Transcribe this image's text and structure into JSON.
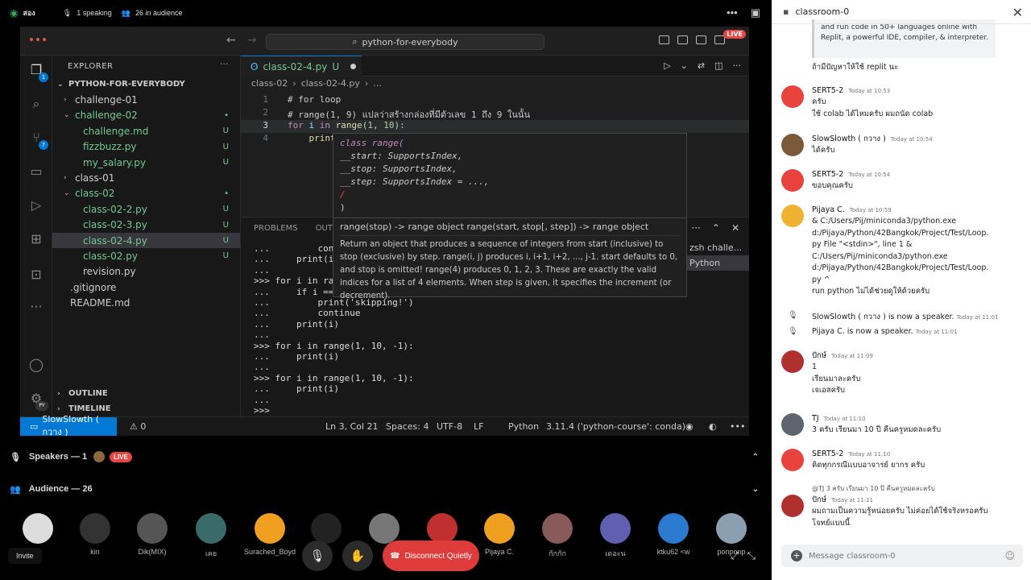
{
  "topbar": {
    "channel": "สอง",
    "speaking": "1 speaking",
    "audience": "26 in audience"
  },
  "vscode": {
    "search": "python-for-everybody",
    "live": "LIVE",
    "explorer_title": "EXPLORER",
    "project": "PYTHON-FOR-EVERYBODY",
    "tree": [
      {
        "label": "challenge-01",
        "indent": 1,
        "chev": "›",
        "cls": "",
        "status": ""
      },
      {
        "label": "challenge-02",
        "indent": 1,
        "chev": "⌄",
        "cls": "teal",
        "status": "•"
      },
      {
        "label": "challenge.md",
        "indent": 2,
        "chev": "",
        "cls": "teal",
        "status": "U"
      },
      {
        "label": "fizzbuzz.py",
        "indent": 2,
        "chev": "",
        "cls": "teal",
        "status": "U"
      },
      {
        "label": "my_salary.py",
        "indent": 2,
        "chev": "",
        "cls": "teal",
        "status": "U"
      },
      {
        "label": "class-01",
        "indent": 1,
        "chev": "›",
        "cls": "",
        "status": ""
      },
      {
        "label": "class-02",
        "indent": 1,
        "chev": "⌄",
        "cls": "teal",
        "status": "•"
      },
      {
        "label": "class-02-2.py",
        "indent": 2,
        "chev": "",
        "cls": "teal",
        "status": "U"
      },
      {
        "label": "class-02-3.py",
        "indent": 2,
        "chev": "",
        "cls": "teal",
        "status": "U"
      },
      {
        "label": "class-02-4.py",
        "indent": 2,
        "chev": "",
        "cls": "teal",
        "status": "U",
        "sel": true
      },
      {
        "label": "class-02.py",
        "indent": 2,
        "chev": "",
        "cls": "teal",
        "status": "U"
      },
      {
        "label": "revision.py",
        "indent": 2,
        "chev": "",
        "cls": "",
        "status": ""
      },
      {
        "label": ".gitignore",
        "indent": 1,
        "chev": "",
        "cls": "",
        "status": ""
      },
      {
        "label": "README.md",
        "indent": 1,
        "chev": "",
        "cls": "",
        "status": ""
      }
    ],
    "outline": "OUTLINE",
    "timeline": "TIMELINE",
    "tab": "class-02-4.py",
    "tab_status": "U",
    "breadcrumb": [
      "class-02",
      "›",
      "class-02-4.py",
      "›",
      "..."
    ],
    "code_lines": [
      "1",
      "2",
      "3",
      "4"
    ],
    "code_comment1": "# for loop",
    "code_comment2": "# range(1, 9) แปลว่าสร้างกล่องที่มีตัวเลข 1 ถึง 9 ในนั้น",
    "sig_class": "class range(",
    "sig_start": "    __start: SupportsIndex,",
    "sig_stop": "    __stop: SupportsIndex,",
    "sig_step": "    __step: SupportsIndex = ...,",
    "sig_slash": "    /",
    "sig_close": ")",
    "doc_head": "range(stop) -> range object range(start, stop[, step]) -> range object",
    "doc_body": "Return an object that produces a sequence of integers from start (inclusive) to stop (exclusive) by step. range(i, j) produces i, i+1, i+2, ..., j-1. start defaults to 0, and stop is omitted! range(4) produces 0, 1, 2, 3. These are exactly the valid indices for a list of 4 elements. When step is given, it specifies the increment (or decrement).",
    "panel_tabs": [
      "PROBLEMS",
      "OUTP"
    ],
    "terminal": "...         cont\n...     print(i)\n...\n>>> for i in rang\n...     if i ==\n...         print('skipping!')\n...         continue\n...     print(i)\n...\n>>> for i in range(1, 10, -1):\n...     print(i)\n...\n>>> for i in range(1, 10, -1):\n...     print(i)\n...\n>>> ",
    "term_list": [
      "zsh  challe...",
      "Python"
    ],
    "status_user": "SlowSlowth ( กวาง )",
    "status_warn": "⚠ 0",
    "status_items": [
      "Ln 3, Col 21",
      "Spaces: 4",
      "UTF-8",
      "LF",
      "Python",
      "3.11.4 ('python-course': conda)"
    ],
    "py_badge": "PY"
  },
  "stage": {
    "speakers": "Speakers — 1",
    "live": "LIVE",
    "audience": "Audience — 26",
    "names": [
      "",
      "kin",
      "Dik(MIX)",
      "เคย",
      "Surached_Boyd",
      "r)",
      "",
      "",
      "Pijaya C.",
      "กักกัก",
      "เดอะน",
      "ktku62 <ᴡ",
      "ponponp"
    ],
    "disconnect": "Disconnect Quietly",
    "invite": "Invite"
  },
  "chat": {
    "channel": "classroom-0",
    "quote": "and run code in 50+ languages online with Replit, a powerful IDE, compiler, & interpreter.",
    "top_line": "ถ้ามีปัญหาให้ใช้ replit นะ",
    "msgs": [
      {
        "name": "SERT5-2",
        "time": "Today at 10:53",
        "lines": [
          "ครับ",
          "ใช้ colab ได้ไหมครับ ผมถนัด colab"
        ]
      },
      {
        "name": "SlowSlowth ( กวาง )",
        "time": "Today at 10:54",
        "lines": [
          "ได้ครับ"
        ]
      },
      {
        "name": "SERT5-2",
        "time": "Today at 10:54",
        "lines": [
          "ขอบคุณครับ"
        ]
      },
      {
        "name": "Pijaya C.",
        "time": "Today at 10:59",
        "lines": [
          "& C:/Users/Pij/miniconda3/python.exe",
          "d:/Pijaya/Python/42Bangkok/Project/Test/Loop.",
          "py  File \"<stdin>\", line 1     &",
          "C:/Users/Pij/miniconda3/python.exe",
          "d:/Pijaya/Python/42Bangkok/Project/Test/Loop.",
          "py    ^",
          "run python ไม่ได้ช่วยดูให้ด้วยครับ"
        ]
      },
      {
        "name": "ปักษ์",
        "time": "Today at 11:09",
        "lines": [
          "1",
          "เรียนมาละครับ",
          "เจเอสครับ"
        ]
      },
      {
        "name": "TJ",
        "time": "Today at 11:10",
        "lines": [
          "3 ครับ เรียนมา 10 ปี คืนครูหมดละครับ"
        ]
      },
      {
        "name": "SERT5-2",
        "time": "Today at 11:10",
        "lines": [
          "คิดทุกกรณีแบบอาจารย์ ยากร ครับ"
        ]
      },
      {
        "name": "ปักษ์",
        "time": "Today at 11:11",
        "lines": [
          "ผมถามเป็นความรู้หน่อยครับ ไม่ค่อยได้ใช้จริงหรอครับ",
          "โจทย์แบบนี้"
        ]
      }
    ],
    "sys1_name": "SlowSlowth ( กวาง )",
    "sys1_text": "is now a speaker.",
    "sys1_time": "Today at 11:01",
    "sys2_name": "Pijaya C.",
    "sys2_text": "is now a speaker.",
    "sys2_time": "Today at 11:01",
    "reply": "@TJ 3 ครับ เรียนมา 10 ปี คืนครูหมดละครับ",
    "placeholder": "Message classroom-0"
  }
}
